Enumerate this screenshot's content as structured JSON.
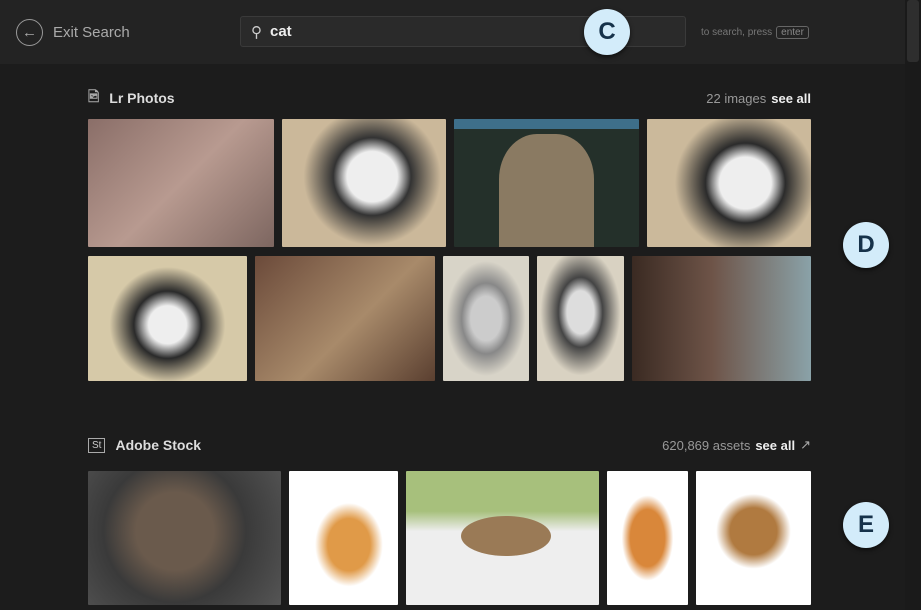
{
  "header": {
    "exit_label": "Exit Search",
    "search_value": "cat",
    "hint": "to search, press",
    "hint_key": "enter"
  },
  "lr": {
    "title": "Lr Photos",
    "count": "22 images",
    "see_all": "see all"
  },
  "stock": {
    "icon_text": "St",
    "title": "Adobe Stock",
    "count": "620,869 assets",
    "see_all": "see all"
  },
  "callouts": {
    "c": "C",
    "d": "D",
    "e": "E"
  },
  "callout_color": "#d3ecfa"
}
